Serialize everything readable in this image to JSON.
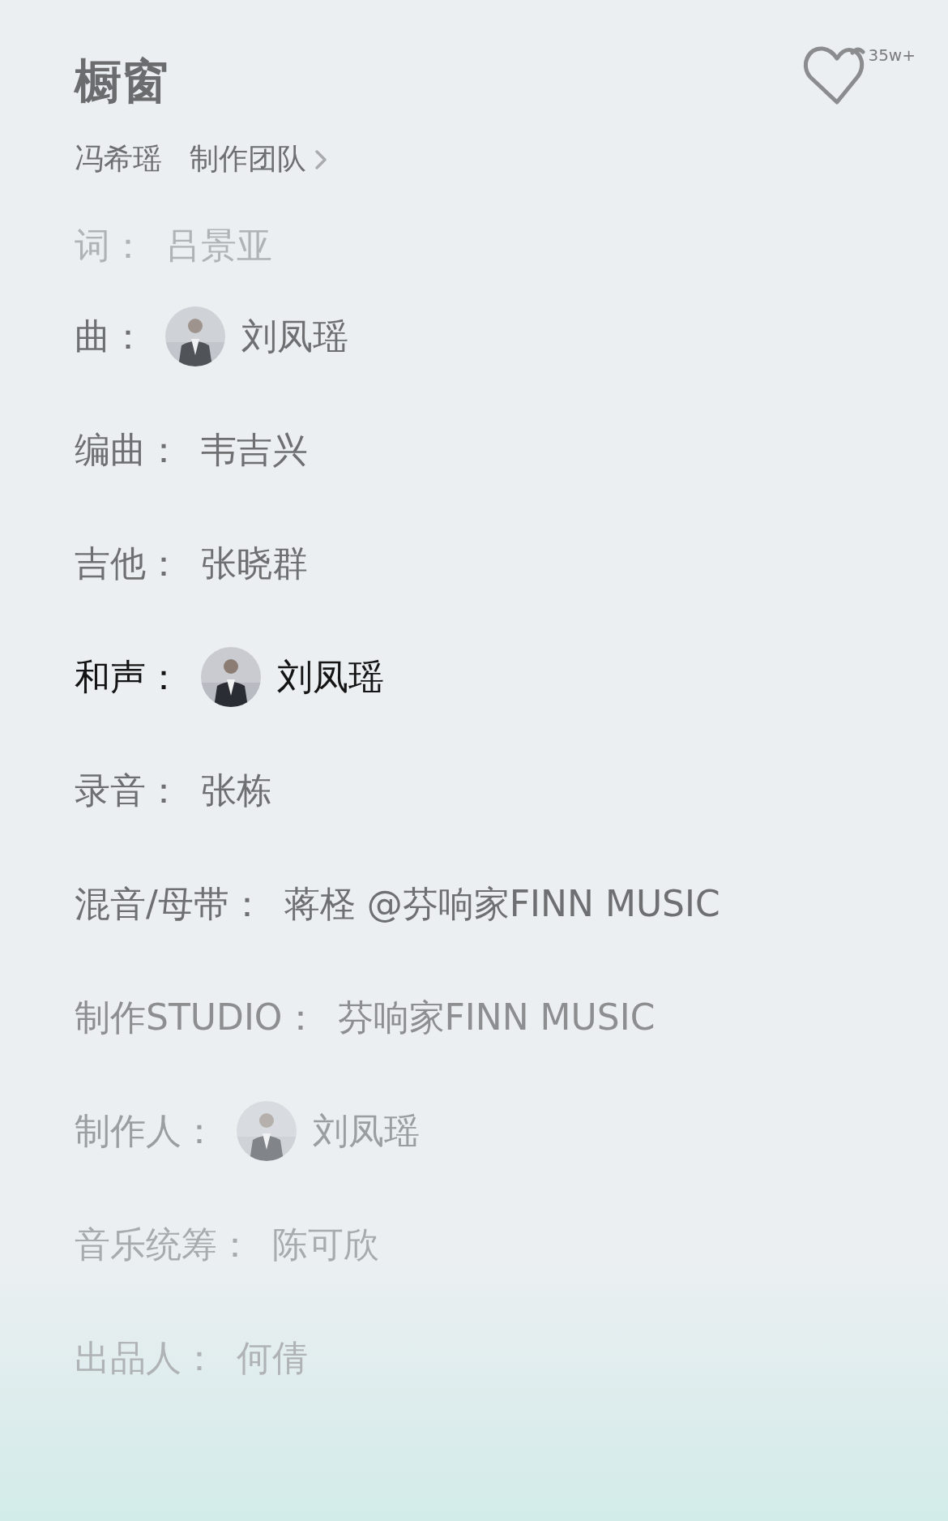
{
  "song": {
    "title": "橱窗",
    "artist": "冯希瑶",
    "team_link": "制作团队",
    "likes": "35w+"
  },
  "credits": [
    {
      "label": "词：",
      "name": "吕景亚",
      "selected": false
    },
    {
      "label": "曲：",
      "name": "刘凤瑶",
      "avatar": true,
      "selected": false
    },
    {
      "label": "编曲：",
      "name": "韦吉兴",
      "selected": false
    },
    {
      "label": "吉他：",
      "name": "张晓群",
      "selected": false
    },
    {
      "label": "和声：",
      "name": "刘凤瑶",
      "avatar": true,
      "selected": true
    },
    {
      "label": "录音：",
      "name": "张栋",
      "selected": false
    },
    {
      "label": "混音/母带：",
      "name": "蒋柽 @芬响家FINN MUSIC",
      "selected": false
    },
    {
      "label": "制作STUDIO：",
      "name": "芬响家FINN MUSIC",
      "selected": false
    },
    {
      "label": "制作人：",
      "name": "刘凤瑶",
      "avatar": true,
      "selected": false
    },
    {
      "label": "音乐统筹：",
      "name": "陈可欣",
      "selected": false
    },
    {
      "label": "出品人：",
      "name": "何倩",
      "selected": false
    }
  ]
}
